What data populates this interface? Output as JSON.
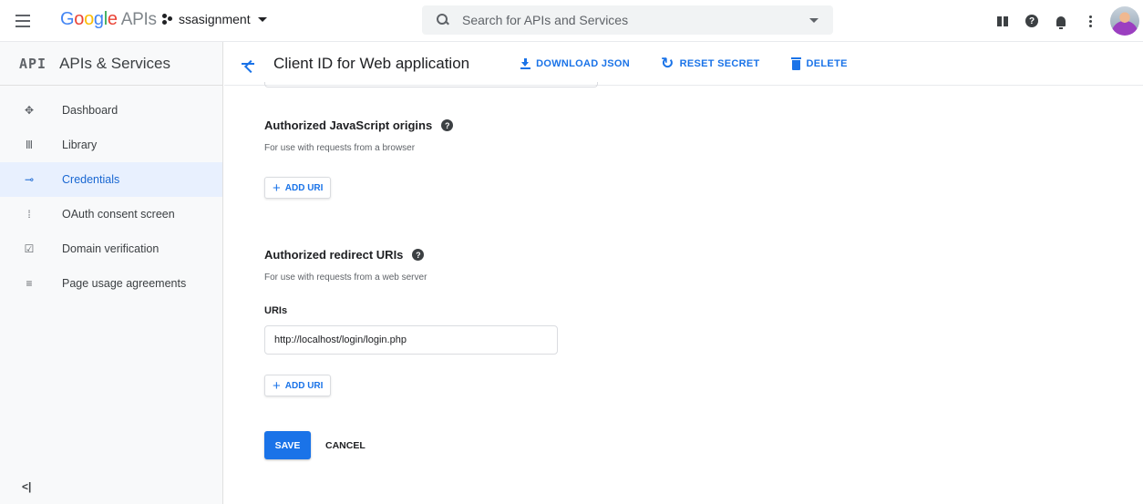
{
  "topbar": {
    "logo_google": "Google",
    "logo_apis": "APIs",
    "project_name": "ssasignment",
    "search_placeholder": "Search for APIs and Services"
  },
  "sidebar": {
    "badge": "API",
    "title": "APIs & Services",
    "items": [
      {
        "label": "Dashboard",
        "icon": "dashboard-icon",
        "active": false
      },
      {
        "label": "Library",
        "icon": "library-icon",
        "active": false
      },
      {
        "label": "Credentials",
        "icon": "key-icon",
        "active": true
      },
      {
        "label": "OAuth consent screen",
        "icon": "consent-icon",
        "active": false
      },
      {
        "label": "Domain verification",
        "icon": "checkbox-icon",
        "active": false
      },
      {
        "label": "Page usage agreements",
        "icon": "settings-list-icon",
        "active": false
      }
    ],
    "collapse_label": "<|"
  },
  "header": {
    "title": "Client ID for Web application",
    "download_label": "DOWNLOAD JSON",
    "reset_label": "RESET SECRET",
    "delete_label": "DELETE"
  },
  "js_origins": {
    "title": "Authorized JavaScript origins",
    "description": "For use with requests from a browser",
    "add_label": "ADD URI"
  },
  "redirect_uris": {
    "title": "Authorized redirect URIs",
    "description": "For use with requests from a web server",
    "uris_label": "URIs",
    "uri_value": "http://localhost/login/login.php",
    "add_label": "ADD URI"
  },
  "actions": {
    "save_label": "SAVE",
    "cancel_label": "CANCEL"
  },
  "colors": {
    "accent": "#1a73e8",
    "active_bg": "#e8f0fe",
    "sidebar_bg": "#f8f9fa"
  }
}
